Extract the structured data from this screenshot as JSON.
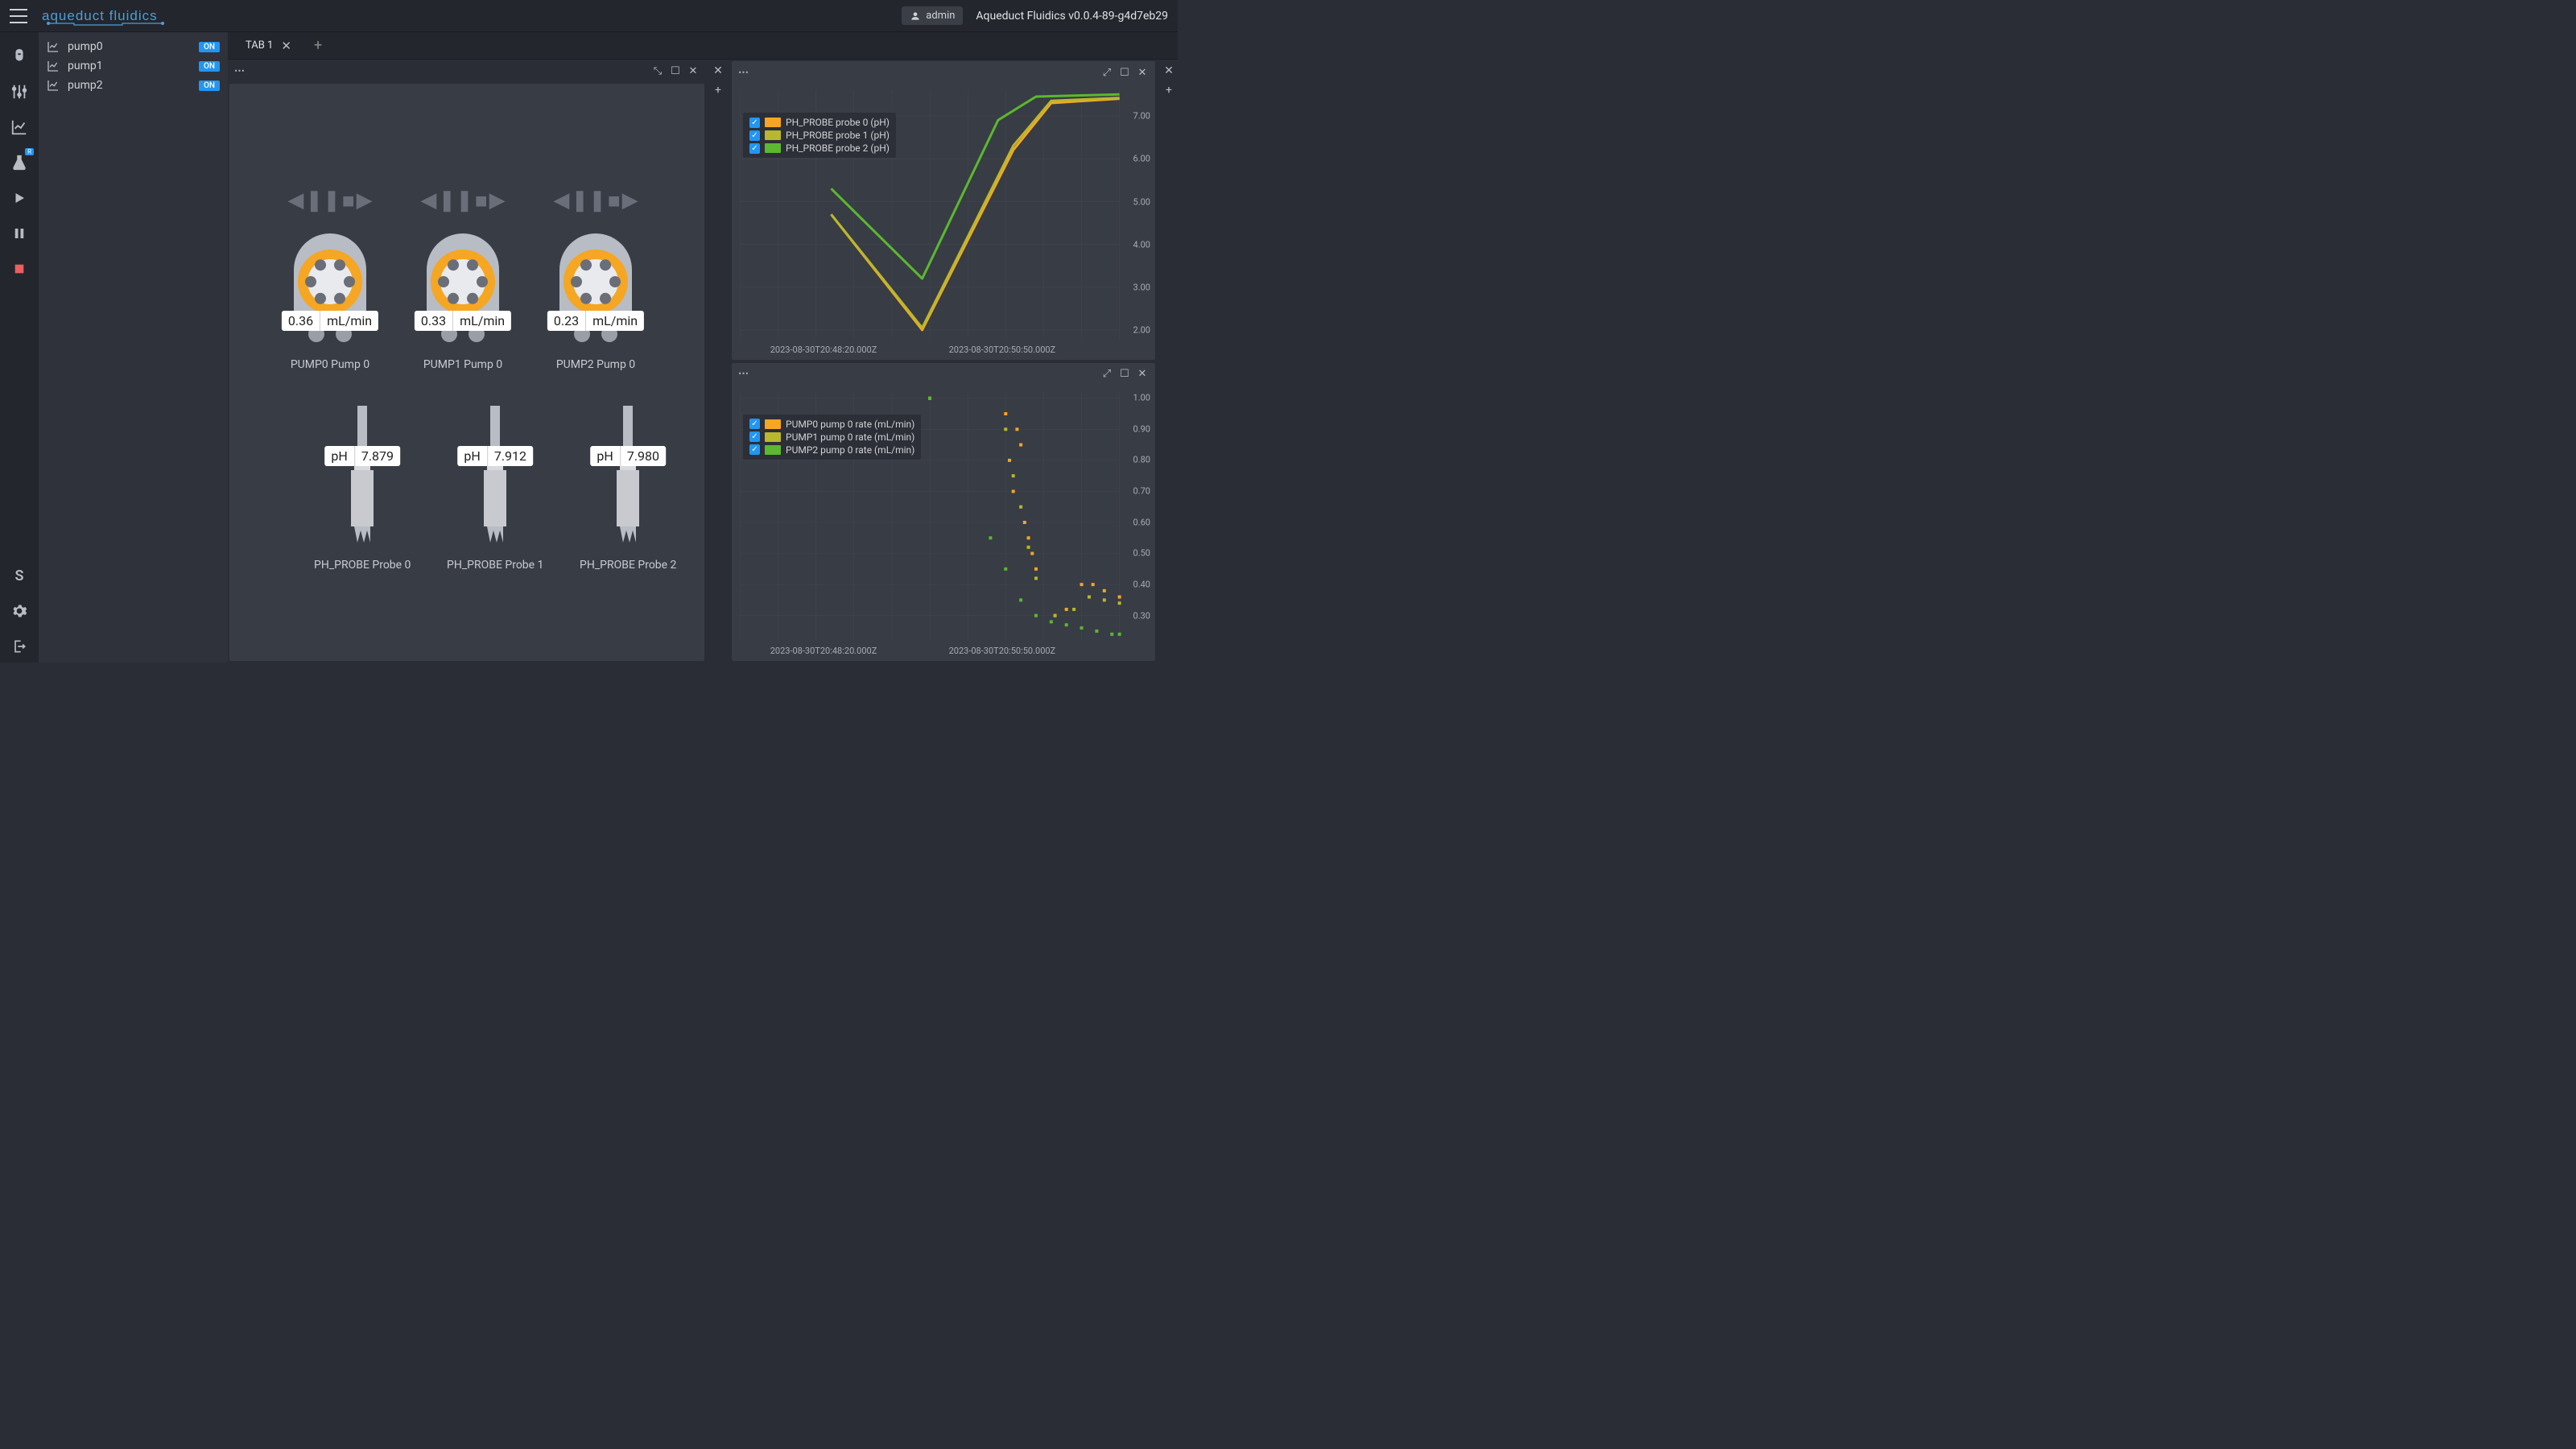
{
  "header": {
    "brand": "aqueduct fluidics",
    "admin_label": "admin",
    "version": "Aqueduct Fluidics v0.0.4-89-g4d7eb29"
  },
  "sidebar_devices": [
    {
      "name": "pump0",
      "badge": "ON"
    },
    {
      "name": "pump1",
      "badge": "ON"
    },
    {
      "name": "pump2",
      "badge": "ON"
    }
  ],
  "tabs": [
    {
      "label": "TAB 1"
    }
  ],
  "rail": {
    "s_label": "S"
  },
  "pumps": [
    {
      "rate": "0.36",
      "unit": "mL/min",
      "label": "PUMP0 Pump 0"
    },
    {
      "rate": "0.33",
      "unit": "mL/min",
      "label": "PUMP1 Pump 0"
    },
    {
      "rate": "0.23",
      "unit": "mL/min",
      "label": "PUMP2 Pump 0"
    }
  ],
  "probes": [
    {
      "prefix": "pH",
      "value": "7.879",
      "label": "PH_PROBE Probe 0"
    },
    {
      "prefix": "pH",
      "value": "7.912",
      "label": "PH_PROBE Probe 1"
    },
    {
      "prefix": "pH",
      "value": "7.980",
      "label": "PH_PROBE Probe 2"
    }
  ],
  "chart_data": [
    {
      "type": "line",
      "title": "",
      "legend": [
        {
          "label": "PH_PROBE probe 0 (pH)",
          "color": "#f5a623"
        },
        {
          "label": "PH_PROBE probe 1 (pH)",
          "color": "#b8b82e"
        },
        {
          "label": "PH_PROBE probe 2 (pH)",
          "color": "#5cb82e"
        }
      ],
      "x_ticks": [
        "2023-08-30T20:48:20.000Z",
        "2023-08-30T20:50:50.000Z"
      ],
      "y_ticks": [
        "2.00",
        "3.00",
        "4.00",
        "5.00",
        "6.00",
        "7.00"
      ],
      "ylim": [
        1.8,
        7.6
      ],
      "series": [
        {
          "name": "probe0",
          "color": "#f5a623",
          "points": [
            [
              0.24,
              4.7
            ],
            [
              0.48,
              2.0
            ],
            [
              0.72,
              6.2
            ],
            [
              0.82,
              7.3
            ],
            [
              1.0,
              7.4
            ]
          ]
        },
        {
          "name": "probe1",
          "color": "#b8b82e",
          "points": [
            [
              0.24,
              4.7
            ],
            [
              0.48,
              2.05
            ],
            [
              0.72,
              6.3
            ],
            [
              0.82,
              7.35
            ],
            [
              1.0,
              7.42
            ]
          ]
        },
        {
          "name": "probe2",
          "color": "#5cb82e",
          "points": [
            [
              0.24,
              5.3
            ],
            [
              0.48,
              3.2
            ],
            [
              0.68,
              6.9
            ],
            [
              0.78,
              7.45
            ],
            [
              1.0,
              7.5
            ]
          ]
        }
      ]
    },
    {
      "type": "scatter",
      "title": "",
      "legend": [
        {
          "label": "PUMP0 pump 0 rate (mL/min)",
          "color": "#f5a623"
        },
        {
          "label": "PUMP1 pump 0 rate (mL/min)",
          "color": "#b8b82e"
        },
        {
          "label": "PUMP2 pump 0 rate (mL/min)",
          "color": "#5cb82e"
        }
      ],
      "x_ticks": [
        "2023-08-30T20:48:20.000Z",
        "2023-08-30T20:50:50.000Z"
      ],
      "y_ticks": [
        "0.30",
        "0.40",
        "0.50",
        "0.60",
        "0.70",
        "0.80",
        "0.90",
        "1.00"
      ],
      "ylim": [
        0.22,
        1.02
      ],
      "series": [
        {
          "name": "pump0",
          "color": "#f5a623",
          "points": [
            [
              0.5,
              1.0
            ],
            [
              0.7,
              0.95
            ],
            [
              0.71,
              0.8
            ],
            [
              0.72,
              0.7
            ],
            [
              0.73,
              0.9
            ],
            [
              0.74,
              0.85
            ],
            [
              0.75,
              0.6
            ],
            [
              0.76,
              0.55
            ],
            [
              0.77,
              0.5
            ],
            [
              0.78,
              0.45
            ],
            [
              0.83,
              0.3
            ],
            [
              0.86,
              0.32
            ],
            [
              0.9,
              0.4
            ],
            [
              0.93,
              0.4
            ],
            [
              0.96,
              0.38
            ],
            [
              1.0,
              0.36
            ]
          ]
        },
        {
          "name": "pump1",
          "color": "#b8b82e",
          "points": [
            [
              0.5,
              1.0
            ],
            [
              0.7,
              0.9
            ],
            [
              0.72,
              0.75
            ],
            [
              0.74,
              0.65
            ],
            [
              0.76,
              0.52
            ],
            [
              0.78,
              0.42
            ],
            [
              0.83,
              0.3
            ],
            [
              0.88,
              0.32
            ],
            [
              0.92,
              0.36
            ],
            [
              0.96,
              0.35
            ],
            [
              1.0,
              0.34
            ]
          ]
        },
        {
          "name": "pump2",
          "color": "#5cb82e",
          "points": [
            [
              0.5,
              1.0
            ],
            [
              0.66,
              0.55
            ],
            [
              0.7,
              0.45
            ],
            [
              0.74,
              0.35
            ],
            [
              0.78,
              0.3
            ],
            [
              0.82,
              0.28
            ],
            [
              0.86,
              0.27
            ],
            [
              0.9,
              0.26
            ],
            [
              0.94,
              0.25
            ],
            [
              0.98,
              0.24
            ],
            [
              1.0,
              0.24
            ]
          ]
        }
      ]
    }
  ]
}
